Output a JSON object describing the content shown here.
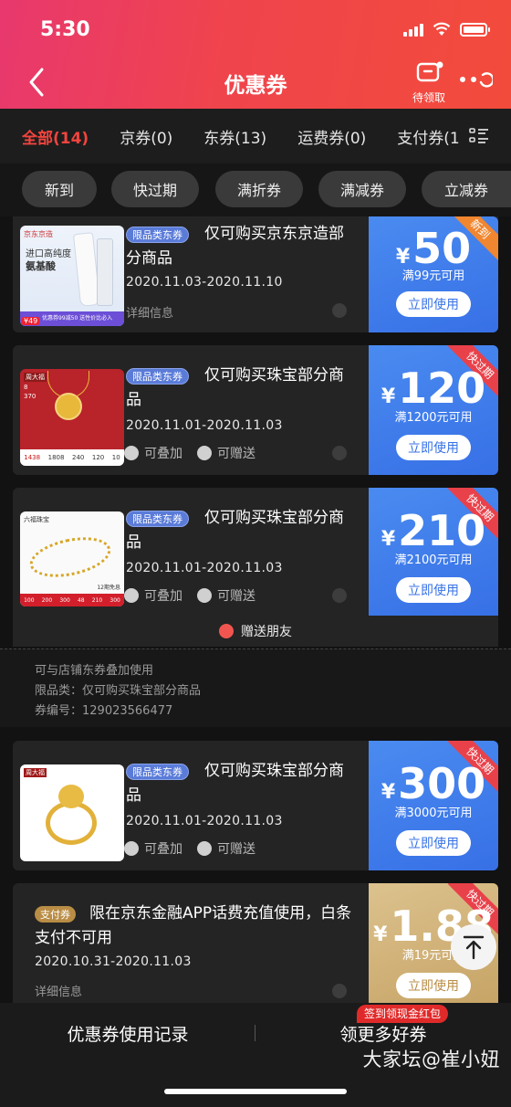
{
  "status": {
    "time": "5:30"
  },
  "header": {
    "title": "优惠券",
    "pending_label": "待领取"
  },
  "tabs": [
    {
      "label": "全部(14)",
      "active": true
    },
    {
      "label": "京券(0)"
    },
    {
      "label": "东券(13)"
    },
    {
      "label": "运费券(0)"
    },
    {
      "label": "支付券(1"
    }
  ],
  "filters": [
    "新到",
    "快过期",
    "满折券",
    "满减券",
    "立减券"
  ],
  "coupons": [
    {
      "badge": "限品类东券",
      "title": "仅可购买京东京造部分商品",
      "date": "2020.11.03-2020.11.10",
      "detail": "详细信息",
      "currency": "¥",
      "amount": "50",
      "condition": "满99元可用",
      "button": "立即使用",
      "ribbon": "新到",
      "thumb_text": [
        "京东京造",
        "进口高纯度",
        "氨基酸",
        "¥49",
        "优惠券99减50 送性价比必入"
      ]
    },
    {
      "badge": "限品类东券",
      "title": "仅可购买珠宝部分商品",
      "date": "2020.11.01-2020.11.03",
      "action1": "可叠加",
      "action2": "可赠送",
      "currency": "¥",
      "amount": "120",
      "condition": "满1200元可用",
      "button": "立即使用",
      "ribbon": "快过期",
      "thumb_text": [
        "周大福",
        "8",
        "370",
        "1438",
        "1808",
        "240",
        "120",
        "10"
      ]
    },
    {
      "badge": "限品类东券",
      "title": "仅可购买珠宝部分商品",
      "date": "2020.11.01-2020.11.03",
      "action1": "可叠加",
      "action2": "可赠送",
      "currency": "¥",
      "amount": "210",
      "condition": "满2100元可用",
      "button": "立即使用",
      "ribbon": "快过期",
      "thumb_text": [
        "六福珠宝",
        "12期免息",
        "100",
        "200",
        "300",
        "210",
        "300",
        "48"
      ],
      "gift": "赠送朋友",
      "info": [
        "可与店铺东券叠加使用",
        "限品类：仅可购买珠宝部分商品",
        "券编号：129023566477"
      ]
    },
    {
      "badge": "限品类东券",
      "title": "仅可购买珠宝部分商品",
      "date": "2020.11.01-2020.11.03",
      "action1": "可叠加",
      "action2": "可赠送",
      "currency": "¥",
      "amount": "300",
      "condition": "满3000元可用",
      "button": "立即使用",
      "ribbon": "快过期",
      "thumb_text": [
        "周大福"
      ]
    },
    {
      "badge": "支付券",
      "title": "限在京东金融APP话费充值使用，白条支付不可用",
      "date": "2020.10.31-2020.11.03",
      "detail": "详细信息",
      "currency": "¥",
      "amount": "1.88",
      "condition": "满19元可用",
      "button": "立即使用",
      "ribbon": "快过期"
    }
  ],
  "bottom": {
    "left": "优惠券使用记录",
    "right": "领更多好券",
    "promo": "签到领现金红包"
  },
  "watermark": "大家坛@崔小妞",
  "colors": {
    "header": "#f0444c",
    "coupon_blue": "#3f7ce9",
    "coupon_gold": "#c9a76a",
    "accent_red": "#f2443e"
  }
}
